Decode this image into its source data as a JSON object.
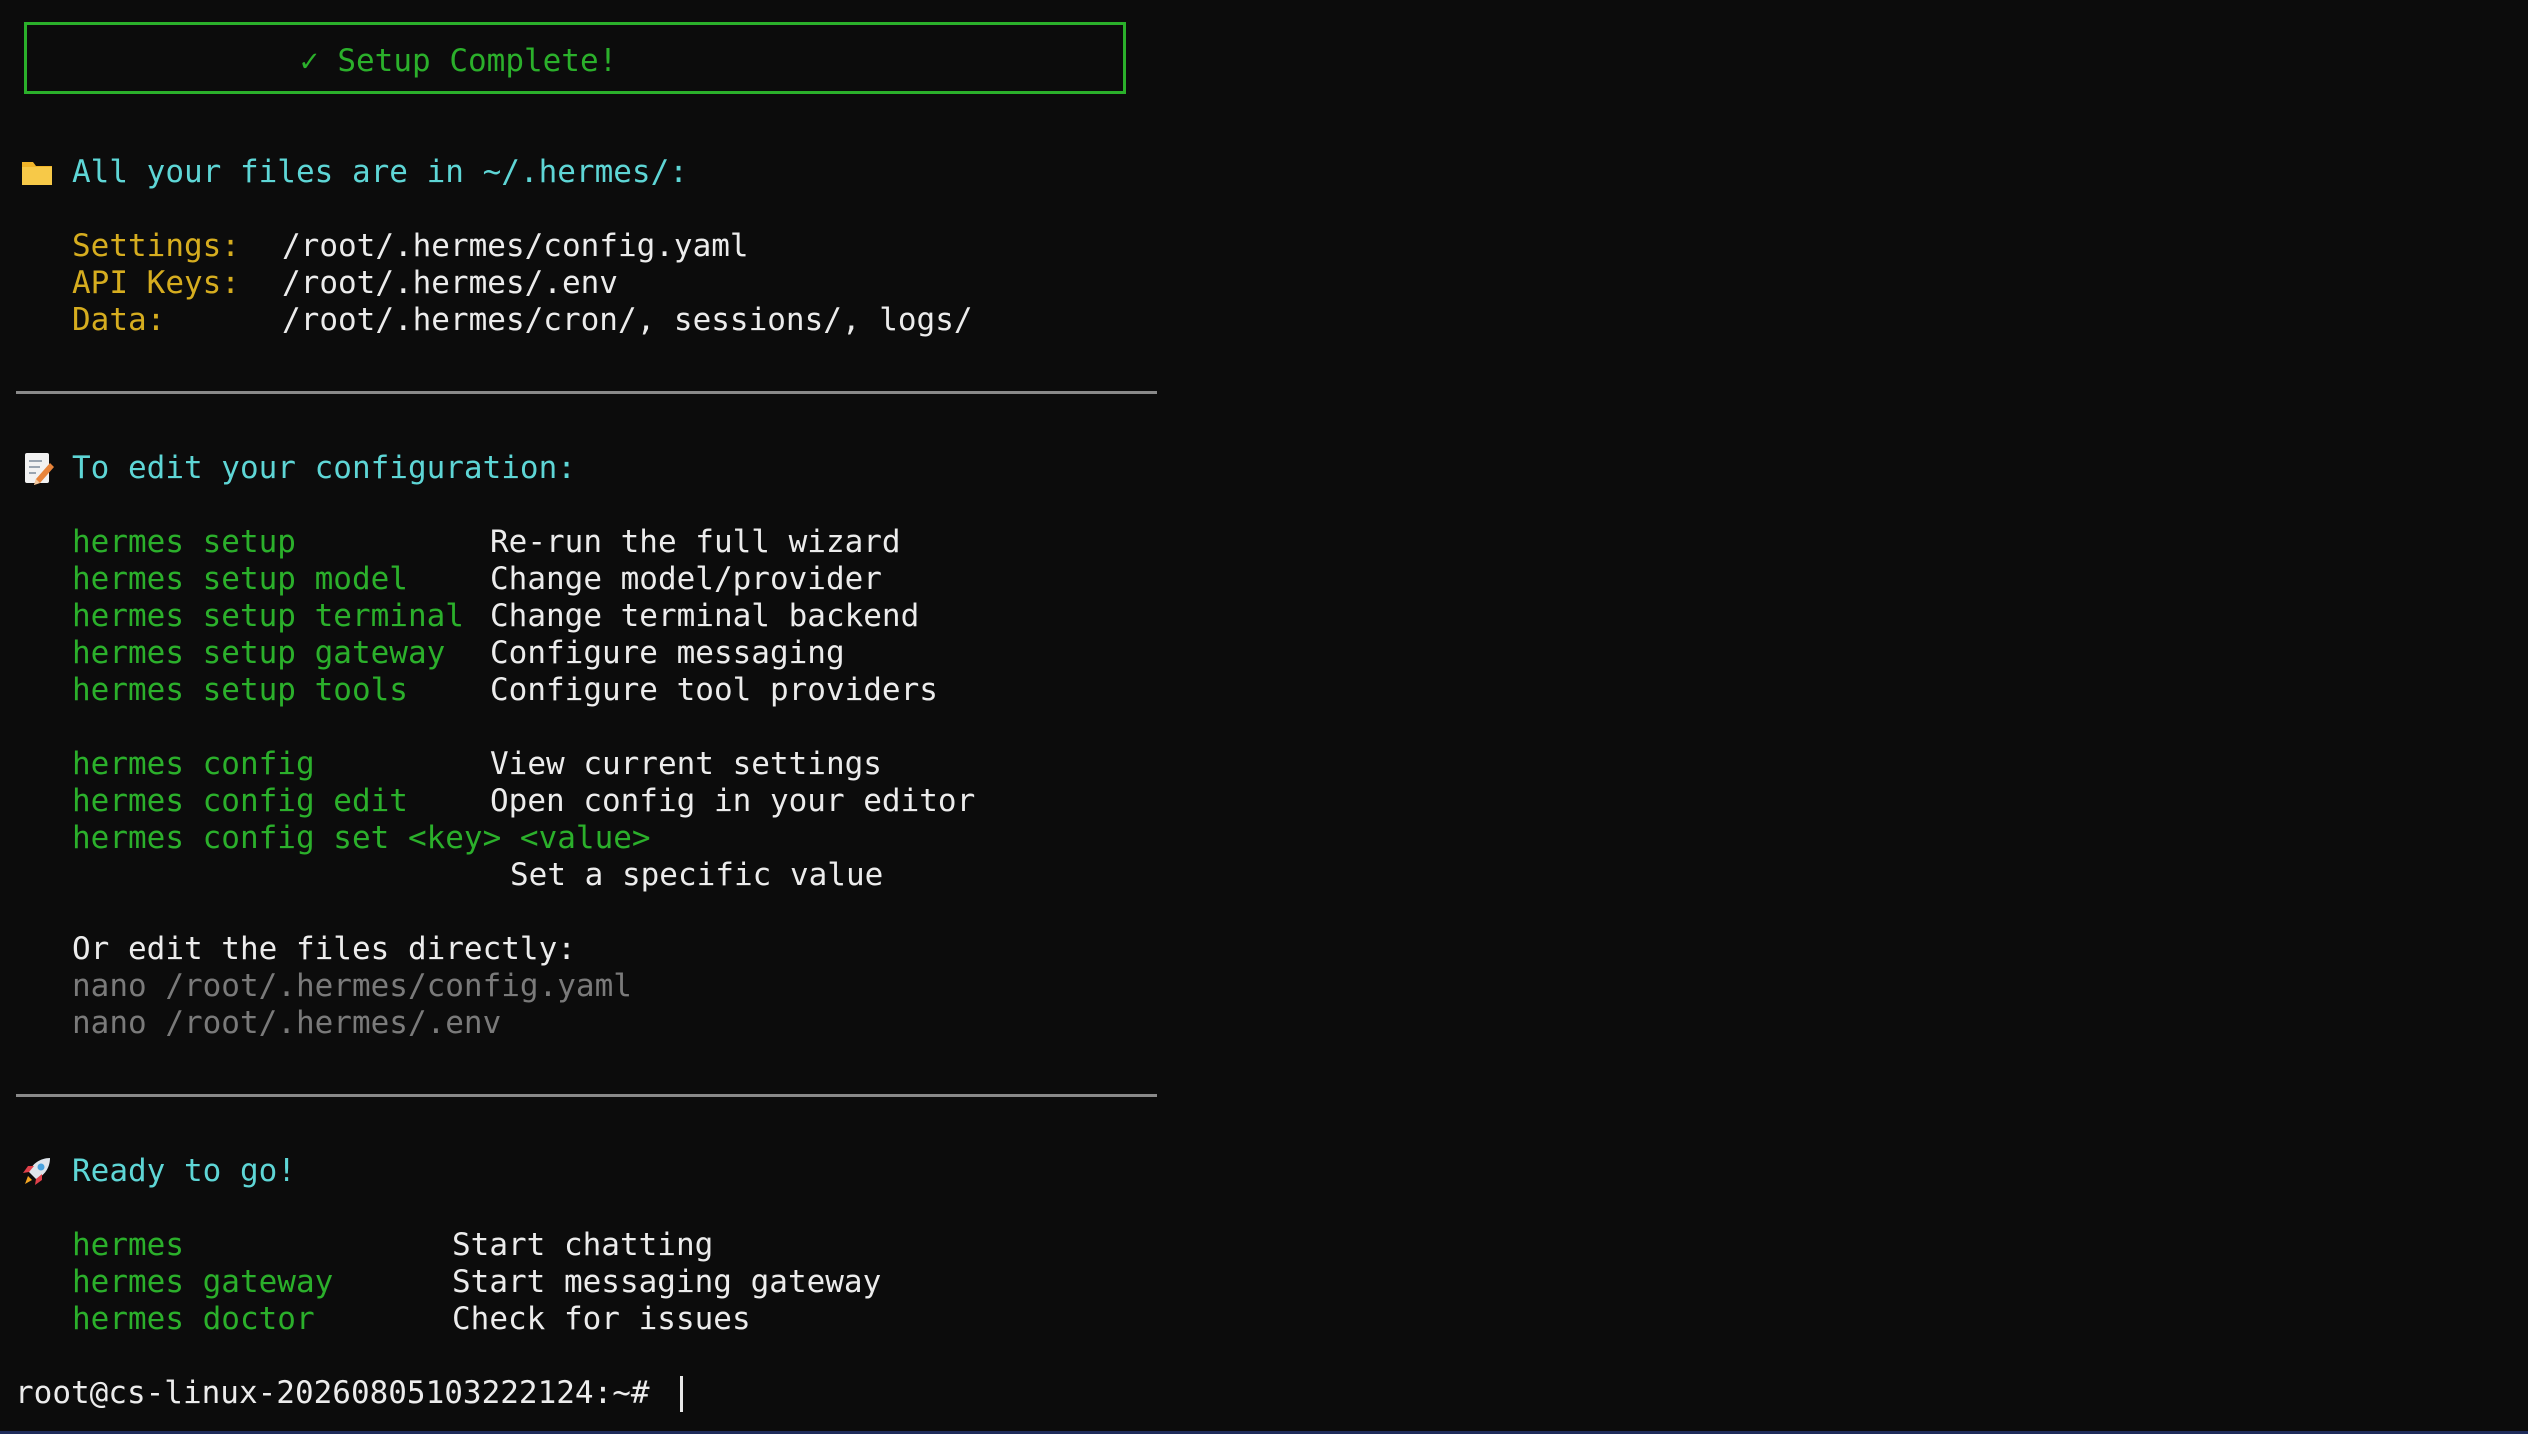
{
  "banner": {
    "check": "✓",
    "text": "Setup Complete!"
  },
  "files_section": {
    "heading": "All your files are in ~/.hermes/:",
    "items": [
      {
        "label": "Settings:",
        "value": "/root/.hermes/config.yaml"
      },
      {
        "label": "API Keys:",
        "value": "/root/.hermes/.env"
      },
      {
        "label": "Data:",
        "value": "/root/.hermes/cron/, sessions/, logs/"
      }
    ]
  },
  "edit_section": {
    "heading": "To edit your configuration:",
    "setup_commands": [
      {
        "cmd": "hermes setup",
        "desc": "Re-run the full wizard"
      },
      {
        "cmd": "hermes setup model",
        "desc": "Change model/provider"
      },
      {
        "cmd": "hermes setup terminal",
        "desc": "Change terminal backend"
      },
      {
        "cmd": "hermes setup gateway",
        "desc": "Configure messaging"
      },
      {
        "cmd": "hermes setup tools",
        "desc": "Configure tool providers"
      }
    ],
    "config_commands": [
      {
        "cmd": "hermes config",
        "desc": "View current settings"
      },
      {
        "cmd": "hermes config edit",
        "desc": "Open config in your editor"
      },
      {
        "cmd": "hermes config set <key> <value>",
        "desc": "Set a specific value"
      }
    ],
    "direct_heading": "Or edit the files directly:",
    "direct_commands": [
      "nano /root/.hermes/config.yaml",
      "nano /root/.hermes/.env"
    ]
  },
  "ready_section": {
    "heading": "Ready to go!",
    "commands": [
      {
        "cmd": "hermes",
        "desc": "Start chatting"
      },
      {
        "cmd": "hermes gateway",
        "desc": "Start messaging gateway"
      },
      {
        "cmd": "hermes doctor",
        "desc": "Check for issues"
      }
    ]
  },
  "prompt": {
    "text": "root@cs-linux-20260805103222124:~#"
  },
  "colors": {
    "background": "#0c0c0c",
    "command": "#2bb02b",
    "heading": "#5ed6d6",
    "label": "#d6ad1f",
    "text": "#ececec",
    "muted": "#7a7a7a"
  },
  "icons": {
    "files": "folder-icon",
    "edit": "memo-icon",
    "ready": "rocket-icon"
  }
}
